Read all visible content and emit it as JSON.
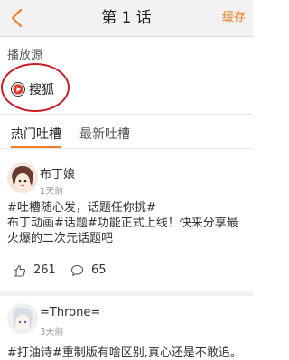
{
  "header": {
    "title": "第 1 话",
    "cache_label": "缓存"
  },
  "source": {
    "section_label": "播放源",
    "selected": "搜狐",
    "accent_color": "#f07d28",
    "highlight_color": "#c8202a"
  },
  "tabs": [
    {
      "label": "热门吐槽",
      "active": true
    },
    {
      "label": "最新吐槽",
      "active": false
    }
  ],
  "posts": [
    {
      "author": "布丁娘",
      "time": "1天前",
      "lines": [
        "#吐槽随心发，话题任你挑#",
        "布丁动画#话题#功能正式上线！快来分享最",
        "火爆的二次元话题吧"
      ],
      "likes": "261",
      "comments": "65"
    },
    {
      "author": "=Throne=",
      "time": "3天前",
      "lines": [
        "#打油诗#重制版有啥区别,真心还是不敢追。"
      ]
    }
  ]
}
